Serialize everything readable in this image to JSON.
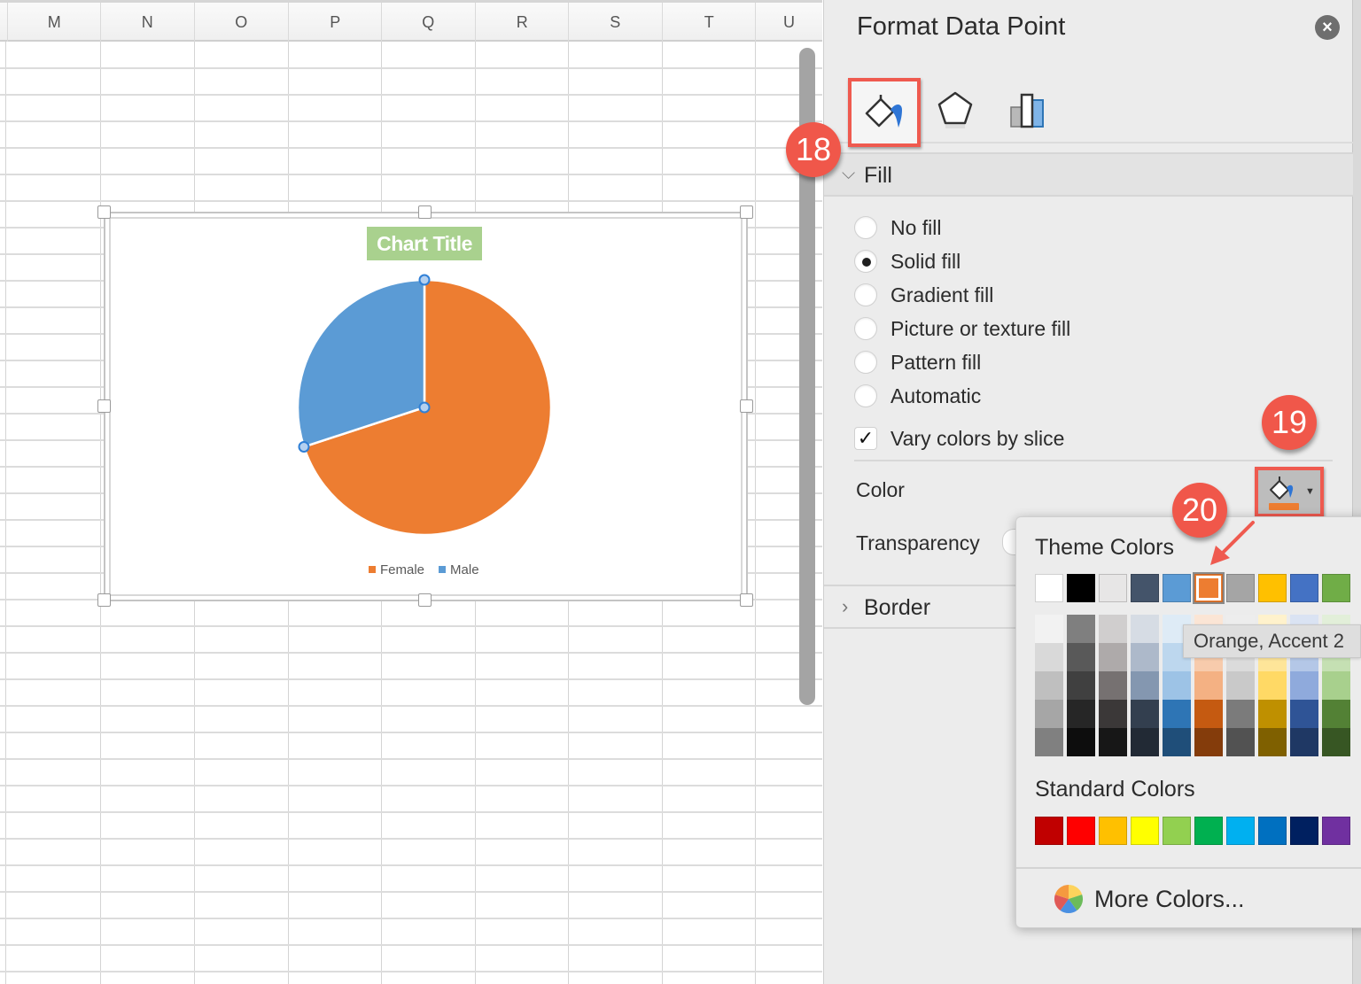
{
  "spreadsheet": {
    "columns": [
      "M",
      "N",
      "O",
      "P",
      "Q",
      "R",
      "S",
      "T",
      "U"
    ]
  },
  "chart_data": {
    "type": "pie",
    "title": "Chart Title",
    "categories": [
      "Female",
      "Male"
    ],
    "values": [
      70,
      30
    ],
    "value_unit": "percent (estimated from slice angles)",
    "colors": [
      "#ed7d31",
      "#5b9bd5"
    ],
    "selected_point": "Male",
    "legend": [
      "Female",
      "Male"
    ],
    "legend_position": "bottom",
    "title_fill": "#a9d18e"
  },
  "pane": {
    "title": "Format Data Point",
    "close_label": "×",
    "tabs": [
      {
        "name": "Fill & Line",
        "icon": "paint-bucket-icon",
        "active": true
      },
      {
        "name": "Effects",
        "icon": "pentagon-icon",
        "active": false
      },
      {
        "name": "Series Options",
        "icon": "bar-chart-icon",
        "active": false
      }
    ],
    "fill_section": {
      "label": "Fill",
      "expanded": true,
      "options": [
        {
          "label": "No fill",
          "checked": false
        },
        {
          "label": "Solid fill",
          "checked": true
        },
        {
          "label": "Gradient fill",
          "checked": false
        },
        {
          "label": "Picture or texture fill",
          "checked": false
        },
        {
          "label": "Pattern fill",
          "checked": false
        },
        {
          "label": "Automatic",
          "checked": false
        }
      ],
      "vary_colors": {
        "label": "Vary colors by slice",
        "checked": true,
        "mark": "✓"
      },
      "color_label": "Color",
      "color_value": "#ed7d31",
      "transparency_label": "Transparency"
    },
    "border_section": {
      "label": "Border",
      "expanded": false
    }
  },
  "color_popover": {
    "theme_heading": "Theme Colors",
    "theme_colors": [
      "#ffffff",
      "#000000",
      "#e7e6e6",
      "#44546a",
      "#5b9bd5",
      "#ed7d31",
      "#a5a5a5",
      "#ffc000",
      "#4472c4",
      "#70ad47"
    ],
    "selected_index": 5,
    "theme_shades": [
      [
        "#f2f2f2",
        "#d9d9d9",
        "#bfbfbf",
        "#a6a6a6",
        "#808080"
      ],
      [
        "#7f7f7f",
        "#595959",
        "#404040",
        "#262626",
        "#0d0d0d"
      ],
      [
        "#d0cece",
        "#aeaaaa",
        "#767171",
        "#3b3838",
        "#171717"
      ],
      [
        "#d6dce4",
        "#adb9ca",
        "#8497b0",
        "#333f4f",
        "#222a35"
      ],
      [
        "#deebf6",
        "#bdd7ee",
        "#9dc3e6",
        "#2e75b5",
        "#1f4e79"
      ],
      [
        "#fbe5d5",
        "#f7cbac",
        "#f4b183",
        "#c55a11",
        "#843c0b"
      ],
      [
        "#ededed",
        "#dbdbdb",
        "#c9c9c9",
        "#7b7b7b",
        "#525252"
      ],
      [
        "#fff2cc",
        "#fee599",
        "#ffd965",
        "#bf9000",
        "#7f6000"
      ],
      [
        "#dae3f3",
        "#b4c7e7",
        "#8faadc",
        "#2f5496",
        "#1f3864"
      ],
      [
        "#e2efd9",
        "#c5e0b3",
        "#a8d08d",
        "#538135",
        "#375623"
      ]
    ],
    "standard_heading": "Standard Colors",
    "standard_colors": [
      "#c00000",
      "#ff0000",
      "#ffc000",
      "#ffff00",
      "#92d050",
      "#00b050",
      "#00b0f0",
      "#0070c0",
      "#002060",
      "#7030a0"
    ],
    "more_colors_label": "More Colors...",
    "tooltip": "Orange, Accent 2"
  },
  "callouts": [
    {
      "number": "18",
      "target": "Fill & Line tab"
    },
    {
      "number": "19",
      "target": "Color button"
    },
    {
      "number": "20",
      "target": "Orange, Accent 2 swatch"
    }
  ],
  "accent_colors": {
    "callout": "#f0574a",
    "highlight_box": "#ef5a4f"
  }
}
